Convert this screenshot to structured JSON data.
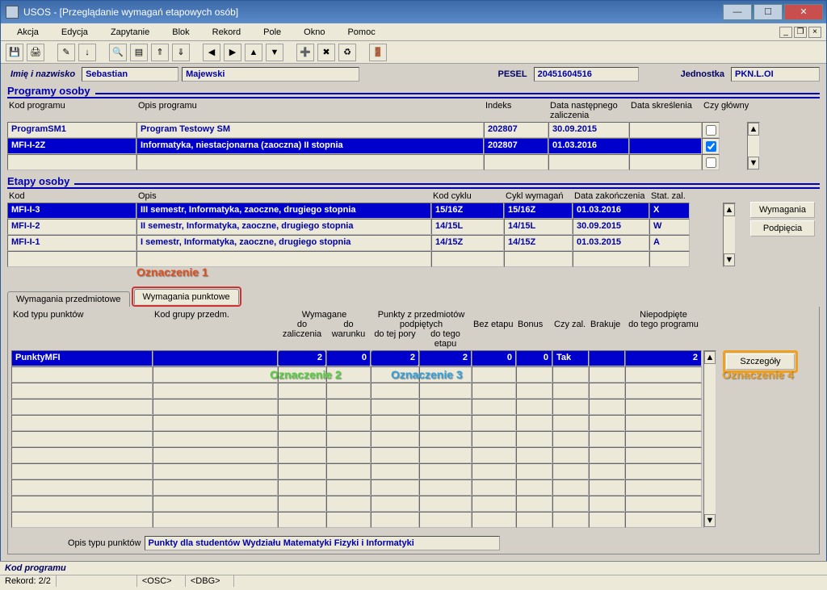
{
  "window": {
    "title": "USOS - [Przeglądanie wymagań etapowych osób]",
    "buttons": {
      "min": "—",
      "max": "☐",
      "close": "✕"
    }
  },
  "menu": {
    "items": [
      "Akcja",
      "Edycja",
      "Zapytanie",
      "Blok",
      "Rekord",
      "Pole",
      "Okno",
      "Pomoc"
    ]
  },
  "header": {
    "name_label": "Imię i nazwisko",
    "first_name": "Sebastian",
    "last_name": "Majewski",
    "pesel_label": "PESEL",
    "pesel": "20451604516",
    "unit_label": "Jednostka",
    "unit": "PKN.L.OI"
  },
  "programy": {
    "title": "Programy osoby",
    "headers": {
      "kod": "Kod programu",
      "opis": "Opis programu",
      "indeks": "Indeks",
      "data_nast": "Data następnego zaliczenia",
      "data_skr": "Data skreślenia",
      "czy_glowny": "Czy główny"
    },
    "rows": [
      {
        "kod": "ProgramSM1",
        "opis": "Program Testowy SM",
        "indeks": "202807",
        "data_nast": "30.09.2015",
        "data_skr": "",
        "glowny": false,
        "selected": false
      },
      {
        "kod": "MFI-I-2Z",
        "opis": "Informatyka, niestacjonarna (zaoczna) II stopnia",
        "indeks": "202807",
        "data_nast": "01.03.2016",
        "data_skr": "",
        "glowny": true,
        "selected": true
      },
      {
        "kod": "",
        "opis": "",
        "indeks": "",
        "data_nast": "",
        "data_skr": "",
        "glowny": false,
        "selected": false
      }
    ]
  },
  "etapy": {
    "title": "Etapy osoby",
    "headers": {
      "kod": "Kod",
      "opis": "Opis",
      "kod_cyklu": "Kod cyklu",
      "cykl_wym": "Cykl wymagań",
      "data_zak": "Data zakończenia",
      "stat": "Stat. zal."
    },
    "rows": [
      {
        "kod": "MFI-I-3",
        "opis": "III semestr, Informatyka, zaoczne, drugiego stopnia",
        "kod_cyklu": "15/16Z",
        "cykl_wym": "15/16Z",
        "data_zak": "01.03.2016",
        "stat": "X",
        "selected": true
      },
      {
        "kod": "MFI-I-2",
        "opis": "II semestr, Informatyka, zaoczne, drugiego stopnia",
        "kod_cyklu": "14/15L",
        "cykl_wym": "14/15L",
        "data_zak": "30.09.2015",
        "stat": "W",
        "selected": false
      },
      {
        "kod": "MFI-I-1",
        "opis": "I semestr, Informatyka, zaoczne, drugiego stopnia",
        "kod_cyklu": "14/15Z",
        "cykl_wym": "14/15Z",
        "data_zak": "01.03.2015",
        "stat": "A",
        "selected": false
      },
      {
        "kod": "",
        "opis": "",
        "kod_cyklu": "",
        "cykl_wym": "",
        "data_zak": "",
        "stat": "",
        "selected": false
      }
    ],
    "side_buttons": {
      "wymagania": "Wymagania",
      "podpiecia": "Podpięcia"
    }
  },
  "annotations": {
    "o1": "Oznaczenie 1",
    "o2": "Oznaczenie 2",
    "o3": "Oznaczenie 3",
    "o4": "Oznaczenie 4"
  },
  "tabs": {
    "przedmiotowe": "Wymagania przedmiotowe",
    "punktowe": "Wymagania punktowe"
  },
  "punkty": {
    "headers": {
      "kod_typu": "Kod typu punktów",
      "kod_grupy": "Kod grupy przedm.",
      "wymagane_top": "Wymagane",
      "do_zal": "do zaliczenia",
      "do_war": "do warunku",
      "punkty_top": "Punkty z przedmiotów podpiętych",
      "do_tej": "do tej pory",
      "do_tego": "do tego etapu",
      "bez_etapu": "Bez etapu",
      "bonus": "Bonus",
      "czy_zal": "Czy zal.",
      "brakuje": "Brakuje",
      "niepodp_top": "Niepodpięte",
      "do_prog": "do tego programu"
    },
    "row": {
      "kod_typu": "PunktyMFI",
      "kod_grupy": "",
      "do_zal": "2",
      "do_war": "0",
      "do_tej": "2",
      "do_tego": "2",
      "bez_etapu": "0",
      "bonus": "0",
      "czy_zal": "Tak",
      "brakuje": "",
      "do_prog": "2"
    },
    "button": "Szczegóły",
    "opis_label": "Opis typu punktów",
    "opis_value": "Punkty dla studentów Wydziału Matematyki Fizyki i Informatyki"
  },
  "status": {
    "line1": "Kod programu",
    "rekord": "Rekord: 2/2",
    "osc": "<OSC>",
    "dbg": "<DBG>"
  }
}
